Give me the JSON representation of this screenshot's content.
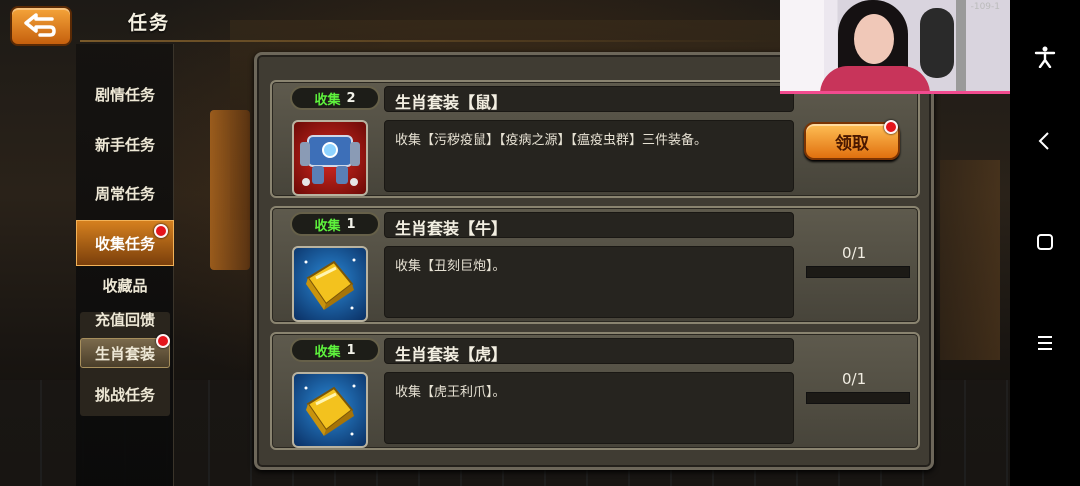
{
  "header": {
    "title": "任务"
  },
  "sidebar": {
    "items": [
      {
        "label": "剧情任务"
      },
      {
        "label": "新手任务"
      },
      {
        "label": "周常任务"
      },
      {
        "label": "收集任务",
        "active": true,
        "has_notification": true
      },
      {
        "label": "挑战任务"
      }
    ],
    "sub_items": [
      {
        "label": "收藏品"
      },
      {
        "label": "充值回馈"
      },
      {
        "label": "生肖套装",
        "active": true,
        "has_notification": true
      }
    ]
  },
  "tasks": [
    {
      "tag": "收集",
      "count": "2",
      "title": "生肖套装【鼠】",
      "description": "收集【污秽疫鼠】【疫病之源】【瘟疫虫群】三件装备。",
      "icon": "mech-robot-icon",
      "action": {
        "label": "领取",
        "has_notification": true
      }
    },
    {
      "tag": "收集",
      "count": "1",
      "title": "生肖套装【牛】",
      "description": "收集【丑刻巨炮】。",
      "icon": "gold-bar-icon",
      "progress": {
        "text": "0/1",
        "fraction": 0
      }
    },
    {
      "tag": "收集",
      "count": "1",
      "title": "生肖套装【虎】",
      "description": "收集【虎王利爪】。",
      "icon": "gold-bar-icon",
      "progress": {
        "text": "0/1",
        "fraction": 0
      }
    }
  ],
  "overlay": {
    "stream_id": "-109-1"
  },
  "colors": {
    "accent_orange": "#e0700f",
    "collect_tag_green": "#5df13c",
    "notification_red": "#e5141b"
  },
  "system_nav": {
    "icons": [
      "accessibility-icon",
      "back-icon",
      "home-icon",
      "menu-icon"
    ]
  }
}
